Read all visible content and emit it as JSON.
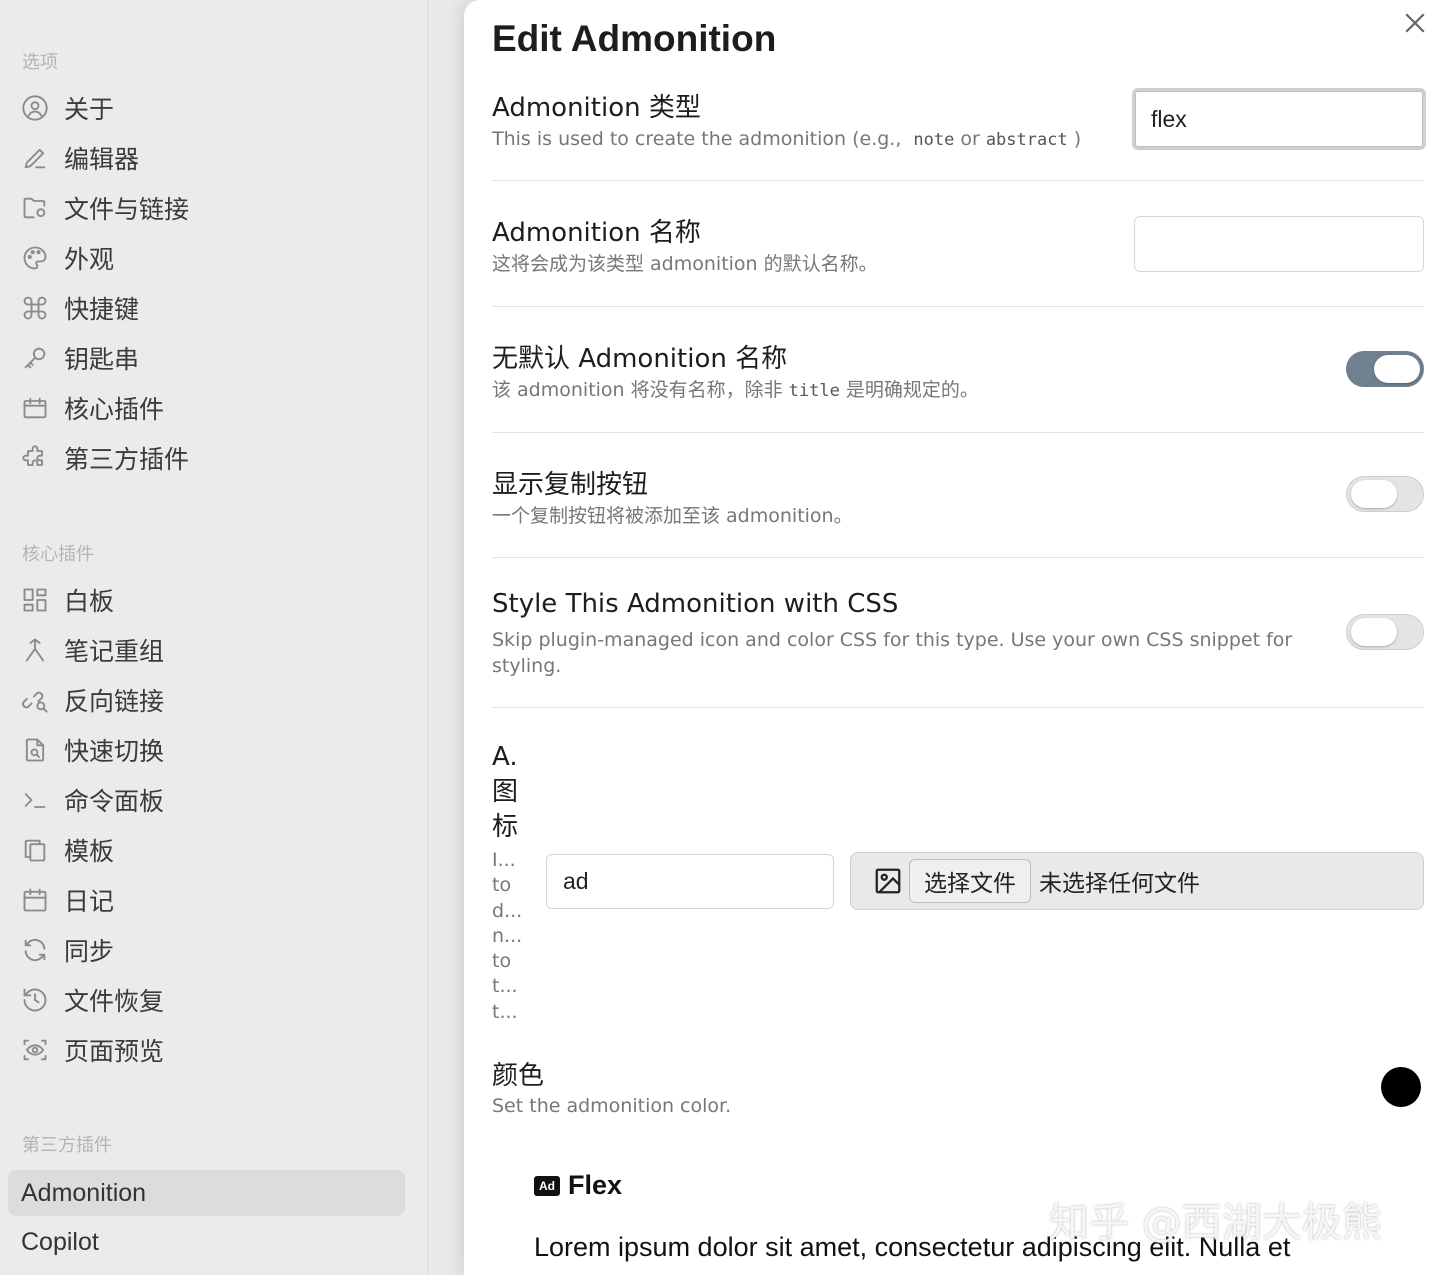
{
  "sidebar": {
    "section_options": "选项",
    "options": [
      {
        "label": "关于",
        "icon": "user-circle-icon"
      },
      {
        "label": "编辑器",
        "icon": "pencil-icon"
      },
      {
        "label": "文件与链接",
        "icon": "folder-cog-icon"
      },
      {
        "label": "外观",
        "icon": "palette-icon"
      },
      {
        "label": "快捷键",
        "icon": "command-icon"
      },
      {
        "label": "钥匙串",
        "icon": "key-icon"
      },
      {
        "label": "核心插件",
        "icon": "calendar-box-icon"
      },
      {
        "label": "第三方插件",
        "icon": "puzzle-icon"
      }
    ],
    "section_core": "核心插件",
    "core": [
      {
        "label": "白板",
        "icon": "layout-grid-icon"
      },
      {
        "label": "笔记重组",
        "icon": "merge-icon"
      },
      {
        "label": "反向链接",
        "icon": "link-search-icon"
      },
      {
        "label": "快速切换",
        "icon": "file-search-icon"
      },
      {
        "label": "命令面板",
        "icon": "terminal-icon"
      },
      {
        "label": "模板",
        "icon": "copy-icon"
      },
      {
        "label": "日记",
        "icon": "calendar-icon"
      },
      {
        "label": "同步",
        "icon": "sync-icon"
      },
      {
        "label": "文件恢复",
        "icon": "history-icon"
      },
      {
        "label": "页面预览",
        "icon": "eye-scan-icon"
      }
    ],
    "section_community": "第三方插件",
    "community": [
      {
        "label": "Admonition",
        "active": true
      },
      {
        "label": "Copilot",
        "active": false
      }
    ]
  },
  "modal": {
    "title": "Edit Admonition",
    "type": {
      "name": "Admonition 类型",
      "desc_prefix": "This is used to create the admonition (e.g.,",
      "code1": "note",
      "desc_mid": "or",
      "code2": "abstract",
      "desc_suffix": ")",
      "value": "flex"
    },
    "title_field": {
      "name": "Admonition 名称",
      "desc": "这将会成为该类型 admonition 的默认名称。",
      "value": ""
    },
    "no_title": {
      "name": "无默认 Admonition 名称",
      "desc_prefix": "该 admonition 将没有名称，除非",
      "code": "title",
      "desc_suffix": "是明确规定的。",
      "on": true
    },
    "copy_button": {
      "name": "显示复制按钮",
      "desc": "一个复制按钮将被添加至该 admonition。",
      "on": false
    },
    "css": {
      "name": "Style This Admonition with CSS",
      "desc": "Skip plugin-managed icon and color CSS for this type. Use your own CSS snippet for styling.",
      "on": false
    },
    "icon": {
      "heading_lines": [
        "A.",
        "图",
        "标"
      ],
      "desc_lines": [
        "I...",
        "to",
        "d...",
        "n...",
        "to",
        "t...",
        "t..."
      ],
      "value": "ad",
      "choose_label": "选择文件",
      "no_file_label": "未选择任何文件"
    },
    "color": {
      "name": "颜色",
      "desc": "Set the admonition color.",
      "value": "#000000"
    },
    "preview": {
      "badge": "Ad",
      "title": "Flex",
      "body": "Lorem ipsum dolor sit amet, consectetur adipiscing elit. Nulla et"
    }
  },
  "watermark": "知乎 @西湖大极熊"
}
